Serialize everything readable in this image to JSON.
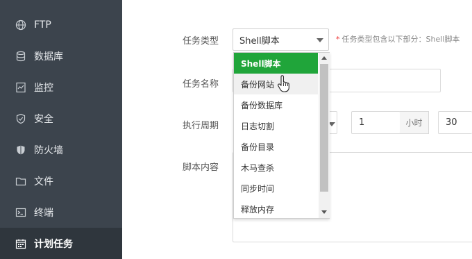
{
  "sidebar": {
    "items": [
      {
        "label": "FTP",
        "icon": "globe-icon"
      },
      {
        "label": "数据库",
        "icon": "database-icon"
      },
      {
        "label": "监控",
        "icon": "monitor-icon"
      },
      {
        "label": "安全",
        "icon": "shield-icon"
      },
      {
        "label": "防火墙",
        "icon": "firewall-icon"
      },
      {
        "label": "文件",
        "icon": "folder-icon"
      },
      {
        "label": "终端",
        "icon": "terminal-icon"
      },
      {
        "label": "计划任务",
        "icon": "calendar-icon",
        "active": true
      }
    ]
  },
  "form": {
    "task_type_label": "任务类型",
    "task_type_value": "Shell脚本",
    "task_type_hint": "任务类型包含以下部分：Shell脚本",
    "task_name_label": "任务名称",
    "period_label": "执行周期",
    "hour_value": "1",
    "hour_unit": "小时",
    "minute_value": "30",
    "script_label": "脚本内容"
  },
  "dropdown": {
    "options": [
      "Shell脚本",
      "备份网站",
      "备份数据库",
      "日志切割",
      "备份目录",
      "木马查杀",
      "同步时间",
      "释放内存"
    ],
    "selected_index": 0,
    "hover_index": 1
  },
  "colors": {
    "sidebar_bg": "#3c444d",
    "sidebar_active_bg": "#2f363d",
    "accent_green": "#20a53a",
    "required_star": "#e33333"
  }
}
